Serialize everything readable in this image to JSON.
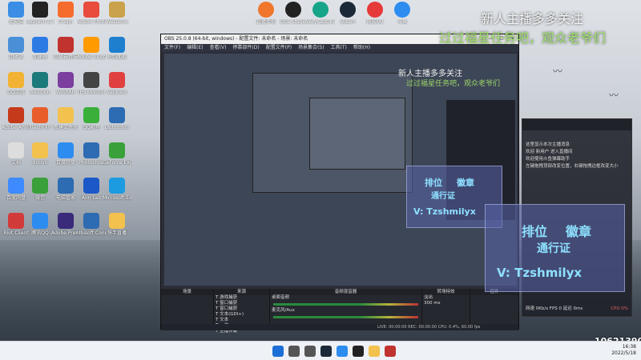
{
  "overlay": {
    "title_main": "新人主播多多关注",
    "subtitle_main": "过过福星任务吧，观众老爷们",
    "title_small": "新人主播多多关注",
    "subtitle_small": "过过福星任务吧，观众老爷们",
    "pass_line1": "排位",
    "pass_line2": "徽章",
    "pass_line3": "通行证",
    "pass_id": "V: Tzshmilyx",
    "viewer_count": "10621390"
  },
  "desktop_icons": [
    {
      "label": "此电脑",
      "color": "#3a8ee6"
    },
    {
      "label": "Logitech G HUB",
      "color": "#222222"
    },
    {
      "label": "Origin",
      "color": "#f56c2d"
    },
    {
      "label": "Adobe Photoshop",
      "color": "#e94b3c"
    },
    {
      "label": "WeGame",
      "color": "#c9a24b"
    },
    {
      "label": "回收站",
      "color": "#4a90d9"
    },
    {
      "label": "加速器",
      "color": "#2c7be5"
    },
    {
      "label": "网易云音乐",
      "color": "#c0332e"
    },
    {
      "label": "Adobe Illustrator",
      "color": "#ff9a00"
    },
    {
      "label": "控制面板",
      "color": "#1e7fcf"
    },
    {
      "label": "QQ游戏",
      "color": "#f2b233"
    },
    {
      "label": "Audition",
      "color": "#1c7a7a"
    },
    {
      "label": "WinRAR",
      "color": "#7b3fa0"
    },
    {
      "label": "FPS Monitor",
      "color": "#444444"
    },
    {
      "label": "Valorant",
      "color": "#e04040"
    },
    {
      "label": "Adobe Animate",
      "color": "#c53a1a"
    },
    {
      "label": "FlashFXP",
      "color": "#e85d2a"
    },
    {
      "label": "新建文件夹",
      "color": "#f2c14e"
    },
    {
      "label": "QQ影音",
      "color": "#3aaf3a"
    },
    {
      "label": "Lightroom",
      "color": "#2d6bb2"
    },
    {
      "label": "文档",
      "color": "#dddddd"
    },
    {
      "label": "dnuyo",
      "color": "#f2c14e"
    },
    {
      "label": "百度网盘",
      "color": "#2d8cf0"
    },
    {
      "label": "Photoshop",
      "color": "#2d6bb2"
    },
    {
      "label": "GeForce Experience",
      "color": "#3aa03a"
    },
    {
      "label": "百度网盘",
      "color": "#3d8bff"
    },
    {
      "label": "微信",
      "color": "#3aa03a"
    },
    {
      "label": "电脑管家",
      "color": "#2d6bb2"
    },
    {
      "label": "Aim Lab",
      "color": "#1c58c7"
    },
    {
      "label": "Microsoft Edge",
      "color": "#1c9be0"
    },
    {
      "label": "Riot Client",
      "color": "#d33b3b"
    },
    {
      "label": "腾讯QQ",
      "color": "#2d8cf0"
    },
    {
      "label": "Adobe Premiere",
      "color": "#3a2a7a"
    },
    {
      "label": "Ubisoft Connect",
      "color": "#2d6bb2"
    },
    {
      "label": "快手直播",
      "color": "#f2c14e"
    }
  ],
  "top_icons": [
    {
      "label": "直播伴侣",
      "color": "#f0762b"
    },
    {
      "label": "OBS Studio",
      "color": "#222222"
    },
    {
      "label": "VeryCapture",
      "color": "#17a589"
    },
    {
      "label": "Steam",
      "color": "#1b2838"
    },
    {
      "label": "网易UU",
      "color": "#e63a3a"
    },
    {
      "label": "斗鱼",
      "color": "#2d8cf0"
    }
  ],
  "obs": {
    "title": "OBS 25.0.8 (64-bit, windows) - 配置文件: 未命名 - 场景: 未命名",
    "menu": [
      "文件(F)",
      "编辑(E)",
      "查看(V)",
      "停靠部件(D)",
      "配置文件(P)",
      "场景集合(S)",
      "工具(T)",
      "帮助(H)"
    ],
    "docks": {
      "scenes_title": "场景",
      "sources_title": "来源",
      "mixer_title": "音频混音器",
      "transitions_title": "转场特效",
      "controls_title": "控件"
    },
    "sources": [
      "游戏捕获",
      "窗口捕获",
      "窗口捕获",
      "文本(GDI+)",
      "文本",
      "一次",
      "主播伴奏"
    ],
    "mixer": [
      {
        "name": "桌面音频",
        "level": "0.0 dB"
      },
      {
        "name": "麦克风/Aux",
        "level": "0.0 dB"
      }
    ],
    "transition": {
      "type": "淡出",
      "duration_label": "时长",
      "duration": "300 ms"
    },
    "status": "LIVE: 00:00:00   REC: 00:00:00   CPU: 0.4%, 60.00 fps"
  },
  "chat": {
    "lines": [
      "这里显示本次主播消息",
      "欢迎 新用户 进入直播间",
      "欢迎使用斗鱼弹幕助手",
      "左键拖拽顶部改变位置，右键拖拽边框改变大小"
    ],
    "footer": "网速 0Kb/s  FPS 0  延迟 0ms",
    "cpu": "CPU 0%"
  },
  "taskbar": {
    "apps": [
      "开始",
      "搜索",
      "任务视图",
      "Steam",
      "QQ",
      "OBS Studio",
      "文件资源管理器",
      "网易云音乐"
    ],
    "time": "16:38",
    "date": "2022/5/18"
  }
}
